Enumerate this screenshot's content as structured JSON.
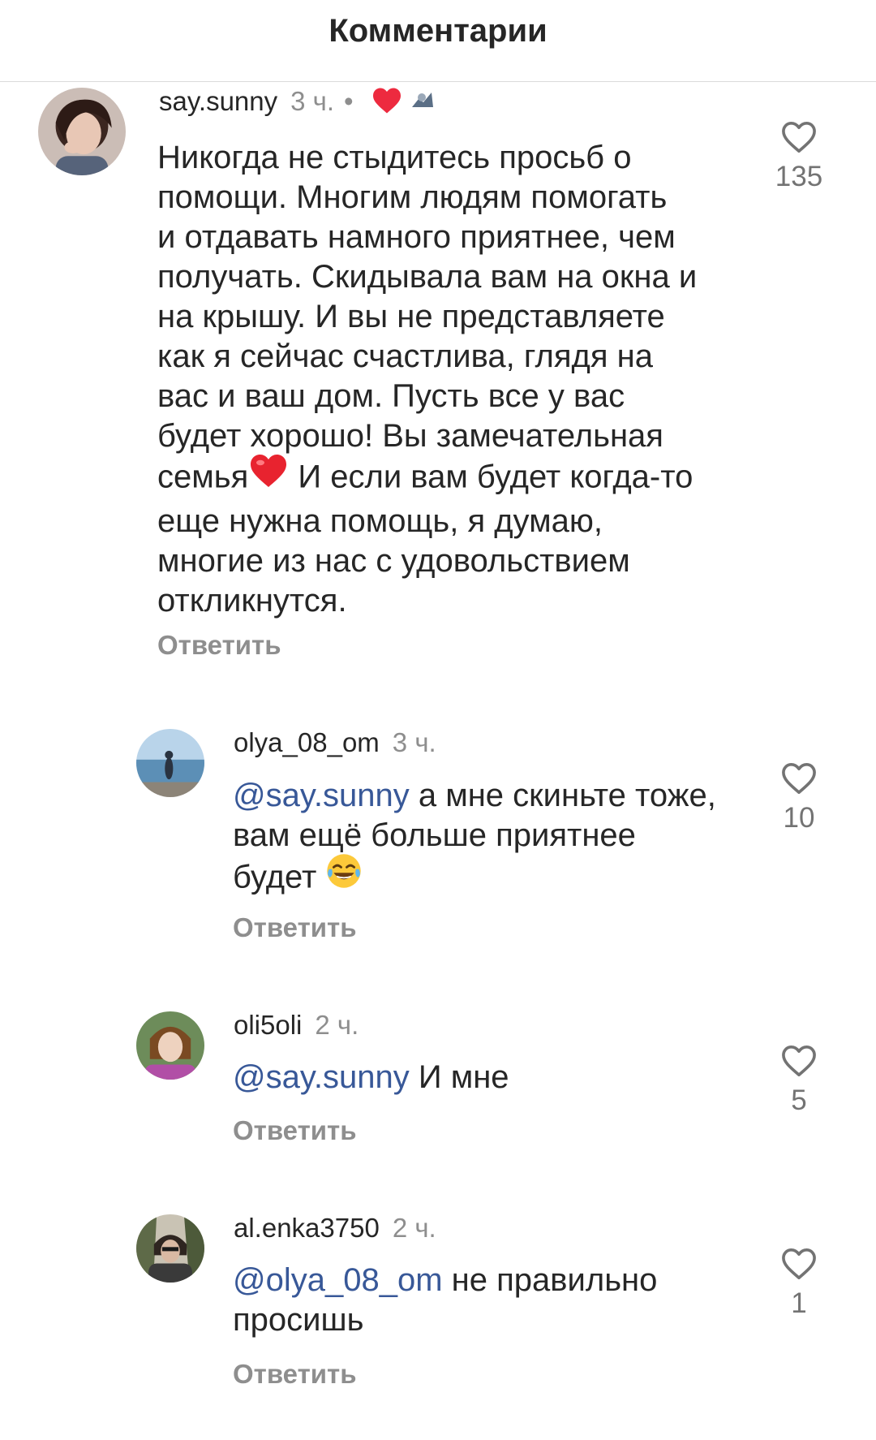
{
  "header": {
    "title": "Комментарии"
  },
  "icons": {
    "like": "heart-outline-icon",
    "author_like": "heart-filled-icon",
    "emoji_heart": "red-heart-emoji",
    "emoji_laugh": "tears-of-joy-emoji"
  },
  "colors": {
    "mention": "#385898",
    "muted": "#8e8e8e",
    "heart_red": "#ed2a3f"
  },
  "comments": [
    {
      "username": "say.sunny",
      "time": "3 ч.",
      "dot": "•",
      "text_1": "Никогда не стыдитесь просьб о\nпомощи. Многим людям помогать\nи отдавать намного приятнее, чем\nполучать. Скидывала вам на окна и\nна крышу. И вы не представляете\nкак я сейчас счастлива, глядя на\nвас и ваш дом. Пусть все у вас\nбудет хорошо! Вы замечательная\nсемья",
      "text_2": " И если вам будет когда-то\nеще нужна помощь, я думаю,\nмногие из нас с удовольствием\nоткликнутся.",
      "reply": "Ответить",
      "likes": "135"
    },
    {
      "username": "olya_08_om",
      "time": "3 ч.",
      "mention": "@say.sunny",
      "text": " а мне скиньте тоже,\nвам ещё больше приятнее\nбудет ",
      "reply": "Ответить",
      "likes": "10"
    },
    {
      "username": "oli5oli",
      "time": "2 ч.",
      "mention": "@say.sunny",
      "text": " И мне",
      "reply": "Ответить",
      "likes": "5"
    },
    {
      "username": "al.enka3750",
      "time": "2 ч.",
      "mention": "@olya_08_om",
      "text": " не правильно\nпросишь",
      "reply": "Ответить",
      "likes": "1"
    }
  ]
}
